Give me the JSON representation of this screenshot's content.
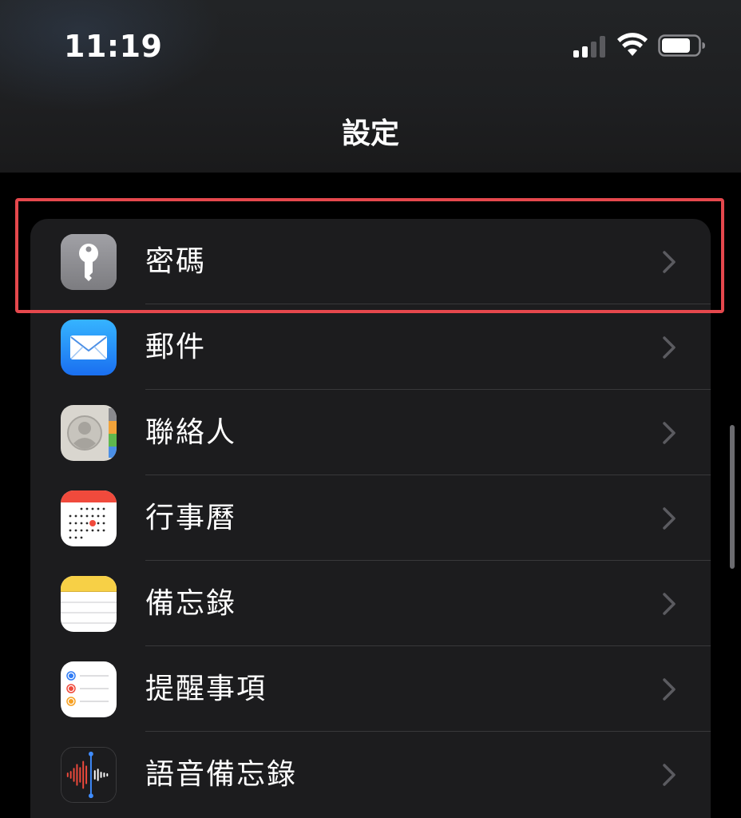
{
  "status_bar": {
    "time": "11:19",
    "signal_bars_active": 2,
    "signal_bars_total": 4,
    "battery_level": 0.8
  },
  "nav": {
    "title": "設定"
  },
  "settings": {
    "items": [
      {
        "label": "密碼",
        "icon": "key-icon",
        "color": "#8e8e93"
      },
      {
        "label": "郵件",
        "icon": "mail-icon",
        "color": "#1e88f0"
      },
      {
        "label": "聯絡人",
        "icon": "contacts-icon",
        "color": "#d8d4ca"
      },
      {
        "label": "行事曆",
        "icon": "calendar-icon",
        "color": "#ffffff"
      },
      {
        "label": "備忘錄",
        "icon": "notes-icon",
        "color": "#f7d046"
      },
      {
        "label": "提醒事項",
        "icon": "reminders-icon",
        "color": "#ffffff"
      },
      {
        "label": "語音備忘錄",
        "icon": "voice-memos-icon",
        "color": "#1c1c1e"
      }
    ]
  },
  "highlight": {
    "color": "#e5484d",
    "target": "密碼"
  }
}
